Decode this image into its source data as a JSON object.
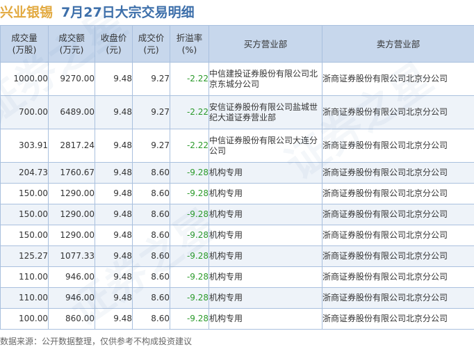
{
  "title": {
    "stock": "兴业银锡",
    "main": "7月27日大宗交易明细"
  },
  "columns": [
    [
      "成交量",
      "(万股)"
    ],
    [
      "成交额",
      "(万元)"
    ],
    [
      "收盘价",
      "(元)"
    ],
    [
      "成交价",
      "(元)"
    ],
    [
      "折溢率",
      "(%)"
    ],
    [
      "买方营业部"
    ],
    [
      "卖方营业部"
    ]
  ],
  "rows": [
    [
      "1000.00",
      "9270.00",
      "9.48",
      "9.27",
      "-2.22",
      "中信建投证券股份有限公司北京东城分公司",
      "浙商证券股份有限公司北京分公司"
    ],
    [
      "700.00",
      "6489.00",
      "9.48",
      "9.27",
      "-2.22",
      "安信证券股份有限公司盐城世纪大道证券营业部",
      "浙商证券股份有限公司北京分公司"
    ],
    [
      "303.91",
      "2817.24",
      "9.48",
      "9.27",
      "-2.22",
      "中信证券股份有限公司大连分公司",
      "浙商证券股份有限公司北京分公司"
    ],
    [
      "204.73",
      "1760.67",
      "9.48",
      "8.60",
      "-9.28",
      "机构专用",
      "浙商证券股份有限公司北京分公司"
    ],
    [
      "150.00",
      "1290.00",
      "9.48",
      "8.60",
      "-9.28",
      "机构专用",
      "浙商证券股份有限公司北京分公司"
    ],
    [
      "150.00",
      "1290.00",
      "9.48",
      "8.60",
      "-9.28",
      "机构专用",
      "浙商证券股份有限公司北京分公司"
    ],
    [
      "150.00",
      "1290.00",
      "9.48",
      "8.60",
      "-9.28",
      "机构专用",
      "浙商证券股份有限公司北京分公司"
    ],
    [
      "125.27",
      "1077.33",
      "9.48",
      "8.60",
      "-9.28",
      "机构专用",
      "浙商证券股份有限公司北京分公司"
    ],
    [
      "110.00",
      "946.00",
      "9.48",
      "8.60",
      "-9.28",
      "机构专用",
      "浙商证券股份有限公司北京分公司"
    ],
    [
      "110.00",
      "946.00",
      "9.48",
      "8.60",
      "-9.28",
      "机构专用",
      "浙商证券股份有限公司北京分公司"
    ],
    [
      "100.00",
      "860.00",
      "9.48",
      "8.60",
      "-9.28",
      "机构专用",
      "浙商证券股份有限公司北京分公司"
    ]
  ],
  "watermark": "证券之星",
  "footer": "数据来源：公开数据整理，仅供参考不构成投资建议",
  "colors": {
    "stock_title": "#e2a93f",
    "main_title": "#3d6faa",
    "header_bg": "#c7d7ec",
    "stripe_bg": "#eef3f9",
    "negative": "#2a9a2a",
    "border": "#a9c0de"
  }
}
